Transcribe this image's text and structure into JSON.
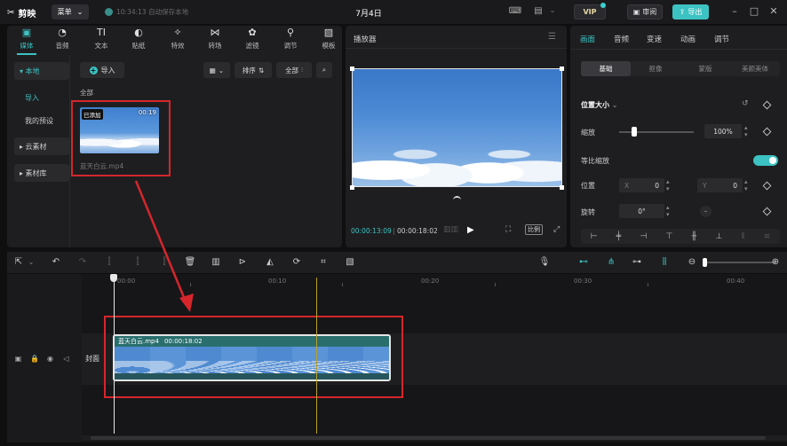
{
  "titlebar": {
    "app_name": "剪映",
    "menu_label": "菜单",
    "autosave_text": "10:34:13 自动保存本地",
    "date": "7月4日",
    "vip_label": "VIP",
    "review_label": "审阅",
    "export_label": "导出"
  },
  "media": {
    "tabs": [
      {
        "label": "媒体",
        "icon": "media-icon"
      },
      {
        "label": "音频",
        "icon": "audio-icon"
      },
      {
        "label": "文本",
        "icon": "text-icon"
      },
      {
        "label": "贴纸",
        "icon": "sticker-icon"
      },
      {
        "label": "特效",
        "icon": "effects-icon"
      },
      {
        "label": "转场",
        "icon": "transition-icon"
      },
      {
        "label": "滤镜",
        "icon": "filter-icon"
      },
      {
        "label": "调节",
        "icon": "adjust-icon"
      },
      {
        "label": "模板",
        "icon": "template-icon"
      }
    ],
    "sidebar": {
      "local": "▾ 本地",
      "import": "导入",
      "presets": "我的预设",
      "cloud": "▸ 云素材",
      "library": "▸ 素材库"
    },
    "import_button": "导入",
    "sort_label": "排序",
    "filter_label": "全部",
    "all_label": "全部",
    "clip": {
      "badge": "已添加",
      "duration": "00:19",
      "name": "蓝天白云.mp4"
    }
  },
  "player": {
    "title": "播放器",
    "current_time": "00:00:13:09",
    "total_time": "00:00:18:02",
    "ratio_label": "比例"
  },
  "properties": {
    "tabs": [
      "画面",
      "音频",
      "变速",
      "动画",
      "调节"
    ],
    "subtabs": [
      "基础",
      "抠像",
      "蒙版",
      "美颜美体"
    ],
    "section_title": "位置大小",
    "scale_label": "缩放",
    "scale_value": "100%",
    "uniform_scale_label": "等比缩放",
    "position_label": "位置",
    "x_label": "X",
    "x_value": "0",
    "y_label": "Y",
    "y_value": "0",
    "rotation_label": "旋转",
    "rotation_value": "0°"
  },
  "timeline": {
    "ruler": [
      "00:00",
      "00:10",
      "00:20",
      "00:30",
      "00:40"
    ],
    "cover_label": "封面",
    "clip_name": "蓝天白云.mp4",
    "clip_duration": "00:00:18:02"
  },
  "colors": {
    "accent": "#3cc2c2",
    "highlight_box": "#d6262c",
    "background": "#0f0f10",
    "panel": "#1e1e20"
  }
}
